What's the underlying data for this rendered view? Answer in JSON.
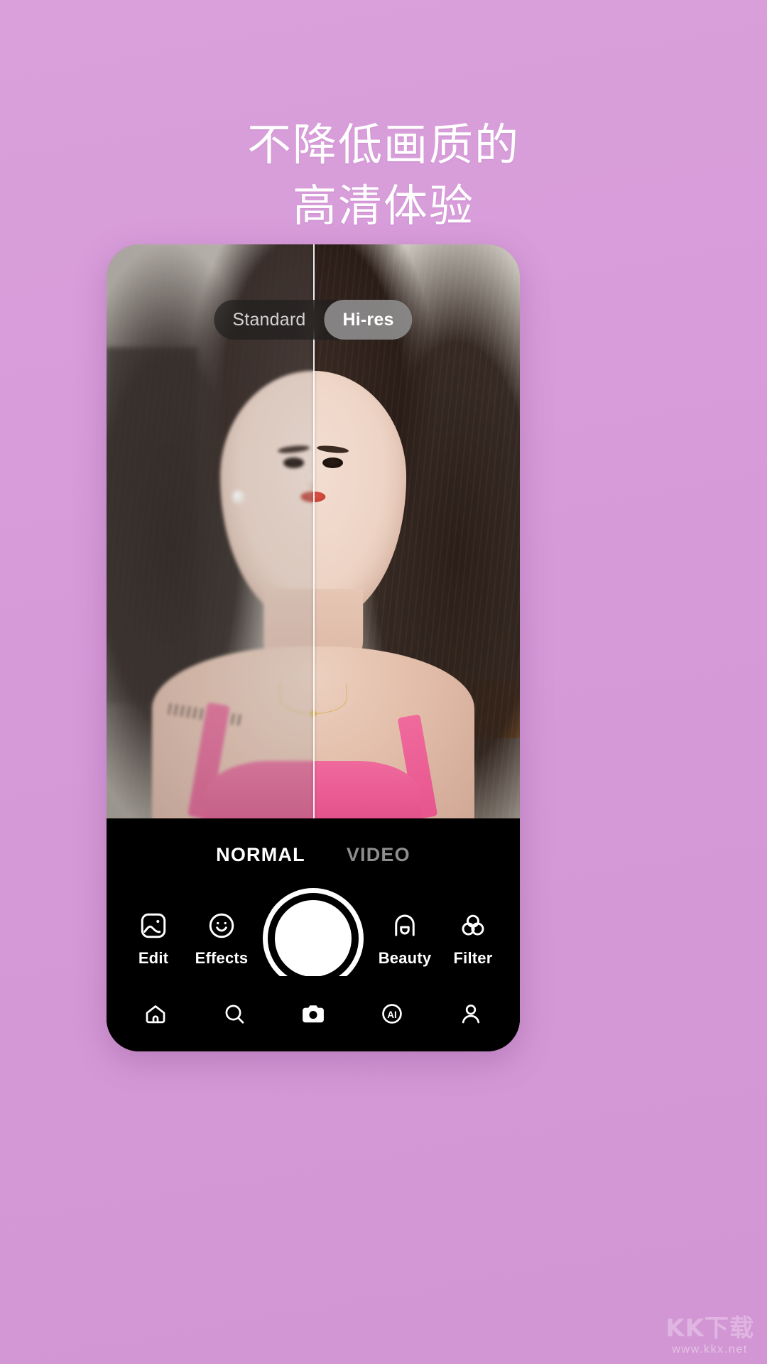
{
  "theme": {
    "background_color": "#d79ad9",
    "headline_color": "#ffffff",
    "panel_color": "#000000",
    "accent_color": "#ffffff",
    "inactive_text_color": "#8e8e8e"
  },
  "headline": {
    "line1": "不降低画质的",
    "line2": "高清体验"
  },
  "phone": {
    "quality_toggle": {
      "options": [
        {
          "label": "Standard",
          "active": false
        },
        {
          "label": "Hi-res",
          "active": true
        }
      ]
    },
    "camera": {
      "mode_tabs": [
        {
          "label": "NORMAL",
          "active": true
        },
        {
          "label": "VIDEO",
          "active": false
        }
      ],
      "shutter_label": "shutter-button",
      "actions": [
        {
          "label": "Edit",
          "icon": "image-edit-icon"
        },
        {
          "label": "Effects",
          "icon": "smiley-face-icon"
        },
        {
          "label": "Beauty",
          "icon": "face-beauty-icon"
        },
        {
          "label": "Filter",
          "icon": "three-circles-filter-icon"
        }
      ]
    },
    "bottom_nav": [
      {
        "icon": "home-icon",
        "active": false
      },
      {
        "icon": "search-icon",
        "active": false
      },
      {
        "icon": "camera-icon",
        "active": true
      },
      {
        "icon": "ai-icon",
        "active": false
      },
      {
        "icon": "profile-icon",
        "active": false
      }
    ]
  },
  "watermark": {
    "text": "KK下载",
    "url": "www.kkx.net"
  }
}
